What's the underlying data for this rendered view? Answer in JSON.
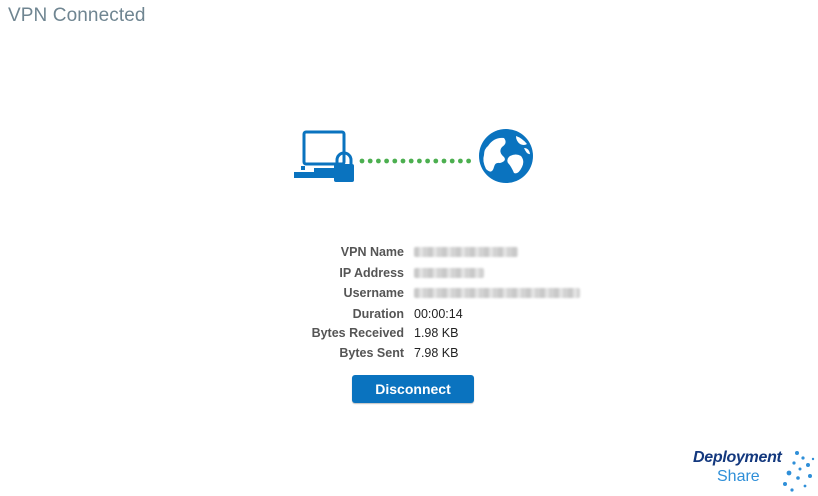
{
  "window": {
    "title": "VPN Connected"
  },
  "illustration": {
    "left_icon": "computer-lock-icon",
    "right_icon": "globe-icon",
    "connector": "dotted-line",
    "accent_color": "#0a73bf",
    "connector_color": "#4caf50"
  },
  "info": {
    "rows": [
      {
        "label": "VPN Name",
        "value": "",
        "redacted": true
      },
      {
        "label": "IP Address",
        "value": "",
        "redacted": true
      },
      {
        "label": "Username",
        "value": "",
        "redacted": true
      },
      {
        "label": "Duration",
        "value": "00:00:14",
        "redacted": false
      },
      {
        "label": "Bytes Received",
        "value": "1.98 KB",
        "redacted": false
      },
      {
        "label": "Bytes Sent",
        "value": "7.98 KB",
        "redacted": false
      }
    ]
  },
  "actions": {
    "disconnect_label": "Disconnect"
  },
  "branding": {
    "line1": "Deployment",
    "line2": "Share"
  }
}
